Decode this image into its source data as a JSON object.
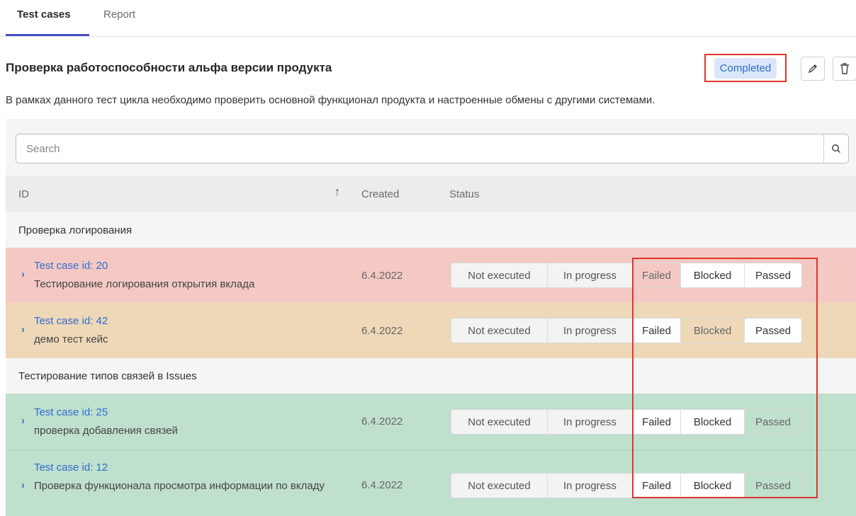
{
  "tabs": [
    {
      "label": "Test cases",
      "active": true
    },
    {
      "label": "Report",
      "active": false
    }
  ],
  "cycle": {
    "title": "Проверка работоспособности альфа версии продукта",
    "status": "Completed",
    "description": "В рамках данного тест цикла необходимо проверить основной функционал продукта и настроенные обмены с другими системами."
  },
  "icons": {
    "edit": "pencil-icon",
    "delete": "trash-icon",
    "search": "search-icon",
    "sort": "arrow-up-icon",
    "expand": "chevron-right-icon"
  },
  "search": {
    "placeholder": "Search",
    "value": ""
  },
  "table": {
    "headers": {
      "id": "ID",
      "created": "Created",
      "status": "Status"
    },
    "status_options": [
      "Not executed",
      "In progress",
      "Failed",
      "Blocked",
      "Passed"
    ],
    "groups": [
      {
        "label": "Проверка логирования",
        "cases": [
          {
            "id": "Test case id: 20",
            "description": "Тестирование логирования открытия вклада",
            "created": "6.4.2022",
            "status": "Failed"
          },
          {
            "id": "Test case id: 42",
            "description": "демо тест кейс",
            "created": "6.4.2022",
            "status": "Blocked"
          }
        ]
      },
      {
        "label": "Тестирование типов связей в Issues",
        "cases": [
          {
            "id": "Test case id: 25",
            "description": "проверка добавления связей",
            "created": "6.4.2022",
            "status": "Passed"
          },
          {
            "id": "Test case id: 12",
            "description": "Проверка функционала просмотра информации по вкладу",
            "created": "6.4.2022",
            "status": "Passed"
          }
        ]
      }
    ]
  },
  "colors": {
    "failed": "#f4c9c3",
    "blocked": "#eed8b8",
    "passed": "#bfe0cd",
    "accent": "#2f6bd0",
    "highlight": "#e0352b"
  }
}
